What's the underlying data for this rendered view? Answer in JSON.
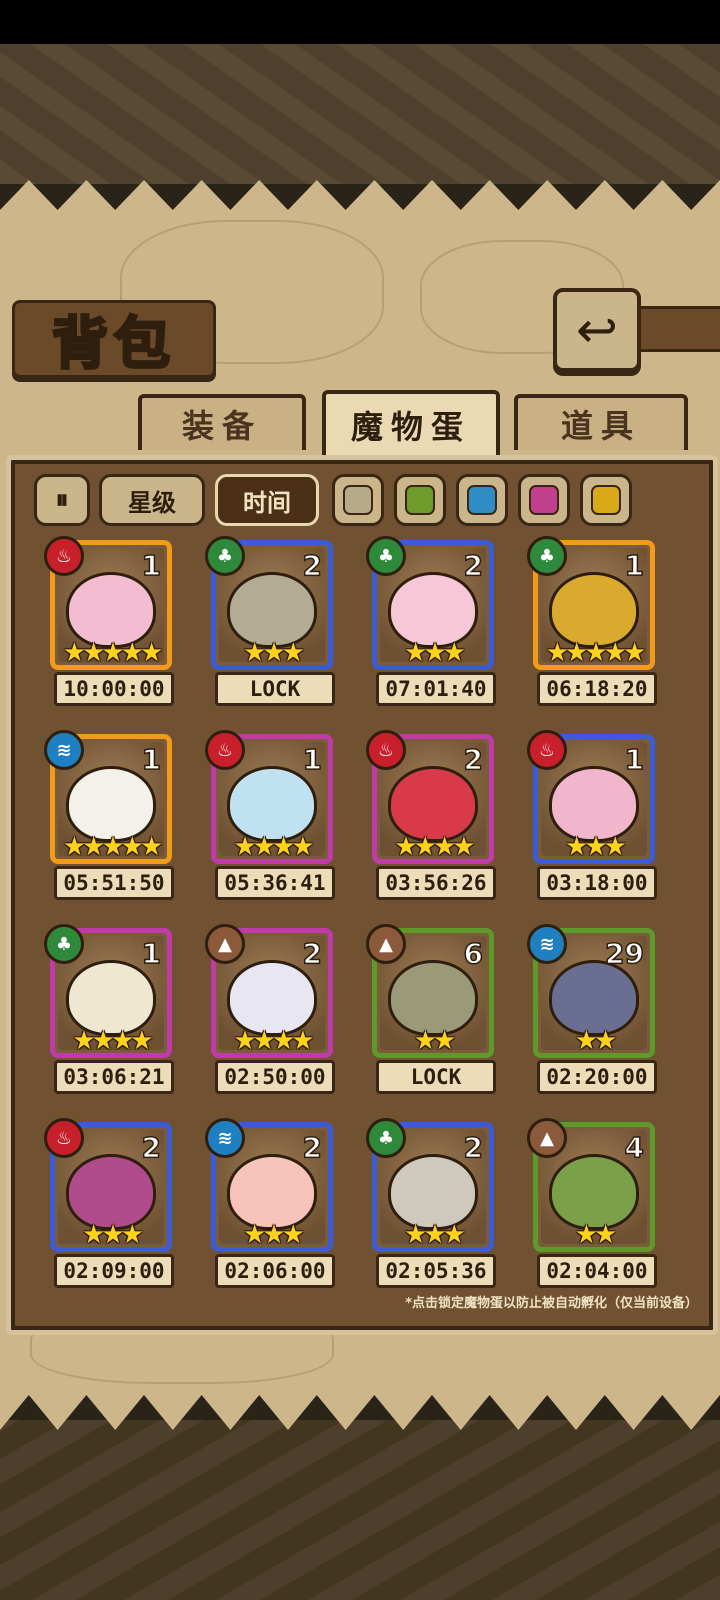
{
  "title": "背包",
  "back_icon": "back-arrow-icon",
  "tabs": [
    {
      "label": "装备",
      "active": false
    },
    {
      "label": "魔物蛋",
      "active": true
    },
    {
      "label": "道具",
      "active": false
    }
  ],
  "sort": {
    "icon": "sort-order-icon",
    "star_label": "星级",
    "time_label": "时间"
  },
  "filters": [
    {
      "name": "all",
      "color": "#b8a98a"
    },
    {
      "name": "green",
      "color": "#6f9a2c"
    },
    {
      "name": "blue",
      "color": "#2f8cc4"
    },
    {
      "name": "pink",
      "color": "#c0408e"
    },
    {
      "name": "yellow",
      "color": "#d9aa18"
    }
  ],
  "eggs": [
    {
      "element": "fire",
      "count": "1",
      "stars": "★★★★★",
      "timer": "10:00:00",
      "rarity": "orange",
      "creature": "pink-cake-creature",
      "color": "#f3bcd0"
    },
    {
      "element": "leaf",
      "count": "2",
      "stars": "★★★",
      "timer": "LOCK",
      "rarity": "blue",
      "creature": "ghost-slime-creature",
      "color": "#b3ab92"
    },
    {
      "element": "leaf",
      "count": "2",
      "stars": "★★★",
      "timer": "07:01:40",
      "rarity": "blue",
      "creature": "lotus-bud-creature",
      "color": "#f6c7d6"
    },
    {
      "element": "leaf",
      "count": "1",
      "stars": "★★★★★",
      "timer": "06:18:20",
      "rarity": "orange",
      "creature": "magic-lamp-creature",
      "color": "#d9aa2e"
    },
    {
      "element": "water",
      "count": "1",
      "stars": "★★★★★",
      "timer": "05:51:50",
      "rarity": "orange",
      "creature": "panda-skull-creature",
      "color": "#f4f1ea"
    },
    {
      "element": "fire",
      "count": "1",
      "stars": "★★★★",
      "timer": "05:36:41",
      "rarity": "purple",
      "creature": "ice-flag-creature",
      "color": "#bfe1f2"
    },
    {
      "element": "fire",
      "count": "2",
      "stars": "★★★★",
      "timer": "03:56:26",
      "rarity": "purple",
      "creature": "kimono-egg-creature",
      "color": "#d93a4a"
    },
    {
      "element": "fire",
      "count": "1",
      "stars": "★★★",
      "timer": "03:18:00",
      "rarity": "blue",
      "creature": "pink-jelly-creature",
      "color": "#f2b6cc"
    },
    {
      "element": "leaf",
      "count": "1",
      "stars": "★★★★",
      "timer": "03:06:21",
      "rarity": "purple",
      "creature": "owl-egg-creature",
      "color": "#efe7d0"
    },
    {
      "element": "earth",
      "count": "2",
      "stars": "★★★★",
      "timer": "02:50:00",
      "rarity": "purple",
      "creature": "bandaged-egg-creature",
      "color": "#e8e6f0"
    },
    {
      "element": "earth",
      "count": "6",
      "stars": "★★",
      "timer": "LOCK",
      "rarity": "green",
      "creature": "stone-planet-creature",
      "color": "#9a9a78"
    },
    {
      "element": "water",
      "count": "29",
      "stars": "★★",
      "timer": "02:20:00",
      "rarity": "green",
      "creature": "clam-shell-creature",
      "color": "#6a6f92"
    },
    {
      "element": "fire",
      "count": "2",
      "stars": "★★★",
      "timer": "02:09:00",
      "rarity": "blue",
      "creature": "mushroom-cap-creature",
      "color": "#b04c8c"
    },
    {
      "element": "water",
      "count": "2",
      "stars": "★★★",
      "timer": "02:06:00",
      "rarity": "blue",
      "creature": "peach-creature",
      "color": "#f8c3b8"
    },
    {
      "element": "leaf",
      "count": "2",
      "stars": "★★★",
      "timer": "02:05:36",
      "rarity": "blue",
      "creature": "spiked-egg-creature",
      "color": "#cfc8bc"
    },
    {
      "element": "earth",
      "count": "4",
      "stars": "★★",
      "timer": "02:04:00",
      "rarity": "green",
      "creature": "sprout-seed-creature",
      "color": "#7aa04a"
    }
  ],
  "element_icons": {
    "fire": "fire-icon",
    "leaf": "leaf-icon",
    "water": "water-icon",
    "earth": "earth-icon"
  },
  "element_glyphs": {
    "fire": "♨",
    "leaf": "♣",
    "water": "≋",
    "earth": "▲"
  },
  "element_colors": {
    "fire": "#c8202a",
    "leaf": "#2e8a3a",
    "water": "#1f7fc0",
    "earth": "#8a5a3a"
  },
  "rarity_colors": {
    "orange": "#f29a1a",
    "blue": "#3a5cd6",
    "purple": "#c03aa8",
    "green": "#5e9a2a"
  },
  "footnote": "*点击锁定魔物蛋以防止被自动孵化（仅当前设备）"
}
